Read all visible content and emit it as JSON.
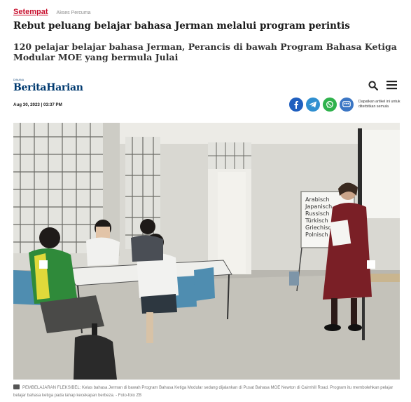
{
  "topline": {
    "section": "Setempat",
    "access": "Akses Percuma"
  },
  "article": {
    "headline": "Rebut peluang belajar bahasa Jerman melalui program perintis",
    "standfirst": "120 pelajar belajar bahasa Jerman, Perancis di bawah Program Bahasa Ketiga Modular MOE yang bermula Julai",
    "dateline": "Aug 30, 2023 | 03:37 PM",
    "caption": "PEMBELAJARAN FLEKSIBEL: Kelas bahasa Jerman di bawah Program Bahasa Ketiga Modular sedang dijalankan di Pusat Bahasa MOE Newton di Cairnhill Road. Program itu membolehkan pelajar belajar bahasa ketiga pada tahap kecekapan berbeza. - Foto-foto ZB"
  },
  "masthead": {
    "brand_small": "DIMANA",
    "brand_name_1": "Berita",
    "brand_name_2": "Harian",
    "search_icon": "search-icon",
    "menu_icon": "hamburger-menu-icon"
  },
  "share": {
    "buttons": [
      {
        "name": "facebook",
        "color": "#1f5fbf"
      },
      {
        "name": "telegram",
        "color": "#2f8fd0"
      },
      {
        "name": "whatsapp",
        "color": "#2fb24c"
      },
      {
        "name": "channel",
        "color": "#3b76c4"
      }
    ],
    "note": "Dapatkan artikel ini untuk diterbitkan semula"
  },
  "photo": {
    "whiteboard_lines": [
      "Arabisch",
      "Japanisch",
      "Russisch",
      "Türkisch",
      "Griechisch",
      "Polnisch"
    ]
  },
  "colors": {
    "section_red": "#c8102e",
    "brand_blue": "#003a70"
  }
}
